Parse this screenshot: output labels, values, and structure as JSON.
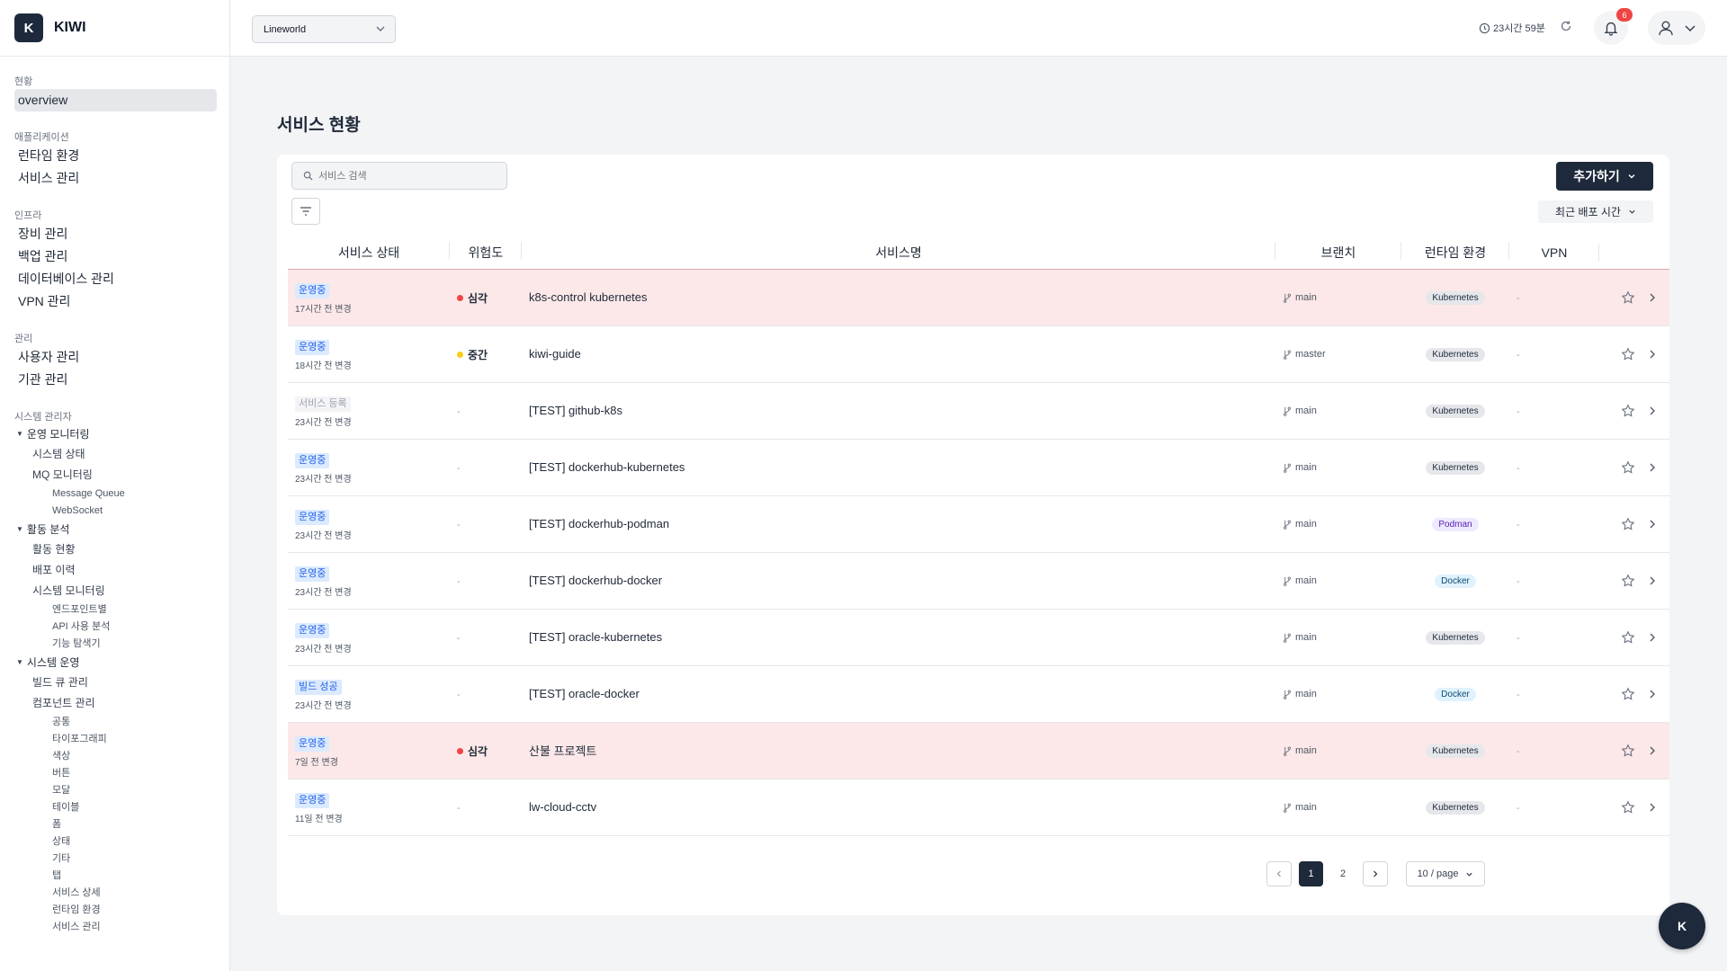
{
  "app": {
    "logo_letter": "K",
    "name": "KIWI"
  },
  "sidebar": {
    "sections": {
      "status": {
        "label": "현황",
        "items": [
          "overview"
        ]
      },
      "apps": {
        "label": "애플리케이션",
        "items": [
          "런타임 환경",
          "서비스 관리"
        ]
      },
      "infra": {
        "label": "인프라",
        "items": [
          "장비 관리",
          "백업 관리",
          "데이터베이스 관리",
          "VPN 관리"
        ]
      },
      "admin": {
        "label": "관리",
        "items": [
          "사용자 관리",
          "기관 관리"
        ]
      },
      "sysadmin": {
        "label": "시스템 관리자"
      }
    },
    "groups": {
      "ops_monitor": {
        "title": "운영 모니터링",
        "sub1": [
          "시스템 상태",
          "MQ 모니터링"
        ],
        "sub2": [
          "Message Queue",
          "WebSocket"
        ]
      },
      "activity": {
        "title": "활동 분석",
        "sub1": [
          "활동 현황",
          "배포 이력",
          "시스템 모니터링"
        ],
        "sub2": [
          "엔드포인트별",
          "API 사용 분석",
          "기능 탐색기"
        ]
      },
      "sysops": {
        "title": "시스템 운영",
        "sub1": [
          "빌드 큐 관리",
          "컴포넌트 관리"
        ],
        "sub2": [
          "공통",
          "타이포그래피",
          "색상",
          "버튼",
          "모달",
          "테이블",
          "폼",
          "상태",
          "기타",
          "탭",
          "서비스 상세",
          "런타임 환경",
          "서비스 관리"
        ]
      }
    }
  },
  "header": {
    "org_select": "Lineworld",
    "timer": "23시간 59분",
    "notification_count": "6"
  },
  "main": {
    "title": "서비스 현황",
    "search_placeholder": "서비스 검색",
    "add_button": "추가하기",
    "sort_label": "최근 배포 시간",
    "columns": {
      "status": "서비스 상태",
      "risk": "위험도",
      "name": "서비스명",
      "branch": "브랜치",
      "runtime": "런타임 환경",
      "vpn": "VPN"
    },
    "rows": [
      {
        "status": "운영중",
        "changed": "17시간 전 변경",
        "risk": "심각",
        "name": "k8s-control kubernetes",
        "branch": "main",
        "runtime": "Kubernetes",
        "vpn": "-"
      },
      {
        "status": "운영중",
        "changed": "18시간 전 변경",
        "risk": "중간",
        "name": "kiwi-guide",
        "branch": "master",
        "runtime": "Kubernetes",
        "vpn": "-"
      },
      {
        "status": "서비스 등록",
        "changed": "23시간 전 변경",
        "risk": "-",
        "name": "[TEST] github-k8s",
        "branch": "main",
        "runtime": "Kubernetes",
        "vpn": "-"
      },
      {
        "status": "운영중",
        "changed": "23시간 전 변경",
        "risk": "-",
        "name": "[TEST] dockerhub-kubernetes",
        "branch": "main",
        "runtime": "Kubernetes",
        "vpn": "-"
      },
      {
        "status": "운영중",
        "changed": "23시간 전 변경",
        "risk": "-",
        "name": "[TEST] dockerhub-podman",
        "branch": "main",
        "runtime": "Podman",
        "vpn": "-"
      },
      {
        "status": "운영중",
        "changed": "23시간 전 변경",
        "risk": "-",
        "name": "[TEST] dockerhub-docker",
        "branch": "main",
        "runtime": "Docker",
        "vpn": "-"
      },
      {
        "status": "운영중",
        "changed": "23시간 전 변경",
        "risk": "-",
        "name": "[TEST] oracle-kubernetes",
        "branch": "main",
        "runtime": "Kubernetes",
        "vpn": "-"
      },
      {
        "status": "빌드 성공",
        "changed": "23시간 전 변경",
        "risk": "-",
        "name": "[TEST] oracle-docker",
        "branch": "main",
        "runtime": "Docker",
        "vpn": "-"
      },
      {
        "status": "운영중",
        "changed": "7일 전 변경",
        "risk": "심각",
        "name": "산불 프로젝트",
        "branch": "main",
        "runtime": "Kubernetes",
        "vpn": "-"
      },
      {
        "status": "운영중",
        "changed": "11일 전 변경",
        "risk": "-",
        "name": "lw-cloud-cctv",
        "branch": "main",
        "runtime": "Kubernetes",
        "vpn": "-"
      }
    ],
    "pagination": {
      "pages": [
        "1",
        "2"
      ],
      "current": "1",
      "per_page": "10 / page"
    }
  },
  "fab_label": "K",
  "colors": {
    "accent": "#1e293b",
    "critical_row": "#fce8e8",
    "critical_dot": "#ef4444",
    "medium_dot": "#facc15",
    "status_blue": "#2563eb"
  }
}
